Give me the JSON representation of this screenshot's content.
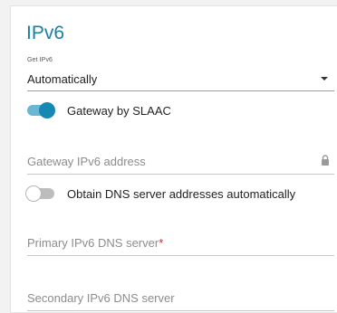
{
  "section": {
    "title": "IPv6"
  },
  "get_ipv6": {
    "label": "Get IPv6",
    "value": "Automatically"
  },
  "gateway_slaac": {
    "label": "Gateway by SLAAC",
    "enabled": true
  },
  "gateway_address": {
    "placeholder": "Gateway IPv6 address",
    "locked": true
  },
  "obtain_dns": {
    "label": "Obtain DNS server addresses automatically",
    "enabled": false
  },
  "primary_dns": {
    "placeholder": "Primary IPv6 DNS server",
    "required_mark": "*"
  },
  "secondary_dns": {
    "placeholder": "Secondary IPv6 DNS server"
  },
  "colors": {
    "accent": "#1a7fa3",
    "toggle_on": "#1589b3",
    "required": "#d9252a"
  },
  "icons": {
    "lock": "lock-icon",
    "dropdown": "caret-down-icon"
  }
}
